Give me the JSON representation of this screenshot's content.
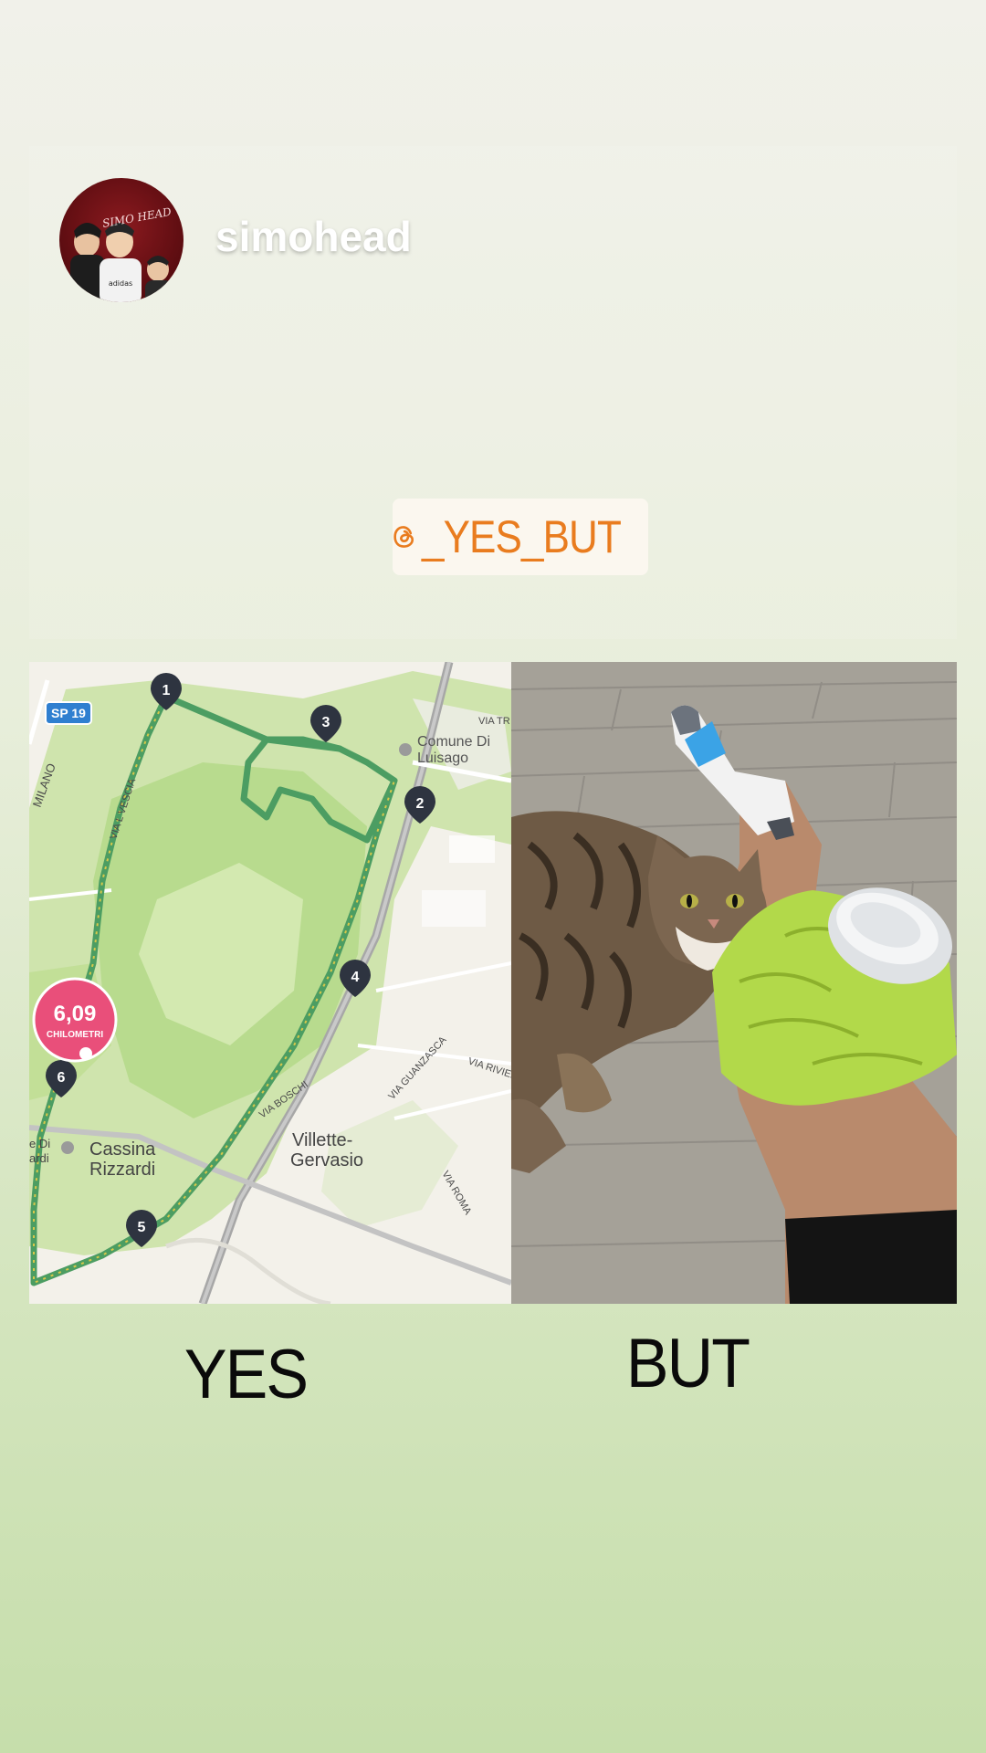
{
  "profile": {
    "username": "simohead",
    "avatar_text": "SIMO HEAD"
  },
  "tag": {
    "text": "_YES_BUT"
  },
  "map": {
    "road_sign": "SP 19",
    "distance_value": "6,09",
    "distance_unit": "CHILOMETRI",
    "places": {
      "comune": "Comune Di",
      "luisago": "Luisago",
      "cassina": "Cassina",
      "rizzardi": "Rizzardi",
      "villette": "Villette-",
      "gervasio": "Gervasio",
      "dir_left_1": "e Di",
      "dir_left_2": "ardi"
    },
    "streets": {
      "milano": "MILANO",
      "vial_vescia": "VIA L VESCIA",
      "via_tr": "VIA TR",
      "via_boschi": "VIA BOSCHI",
      "via_guanzasca": "VIA GUANZASCA",
      "via_rivier": "VIA RIVIER",
      "via_roma": "VIA ROMA"
    },
    "markers": [
      "1",
      "2",
      "3",
      "4",
      "5",
      "6"
    ]
  },
  "captions": {
    "yes": "YES",
    "but": "BUT"
  },
  "colors": {
    "tag_accent": "#e97c1f",
    "distance_badge": "#e94f7a",
    "marker": "#2e3440"
  }
}
